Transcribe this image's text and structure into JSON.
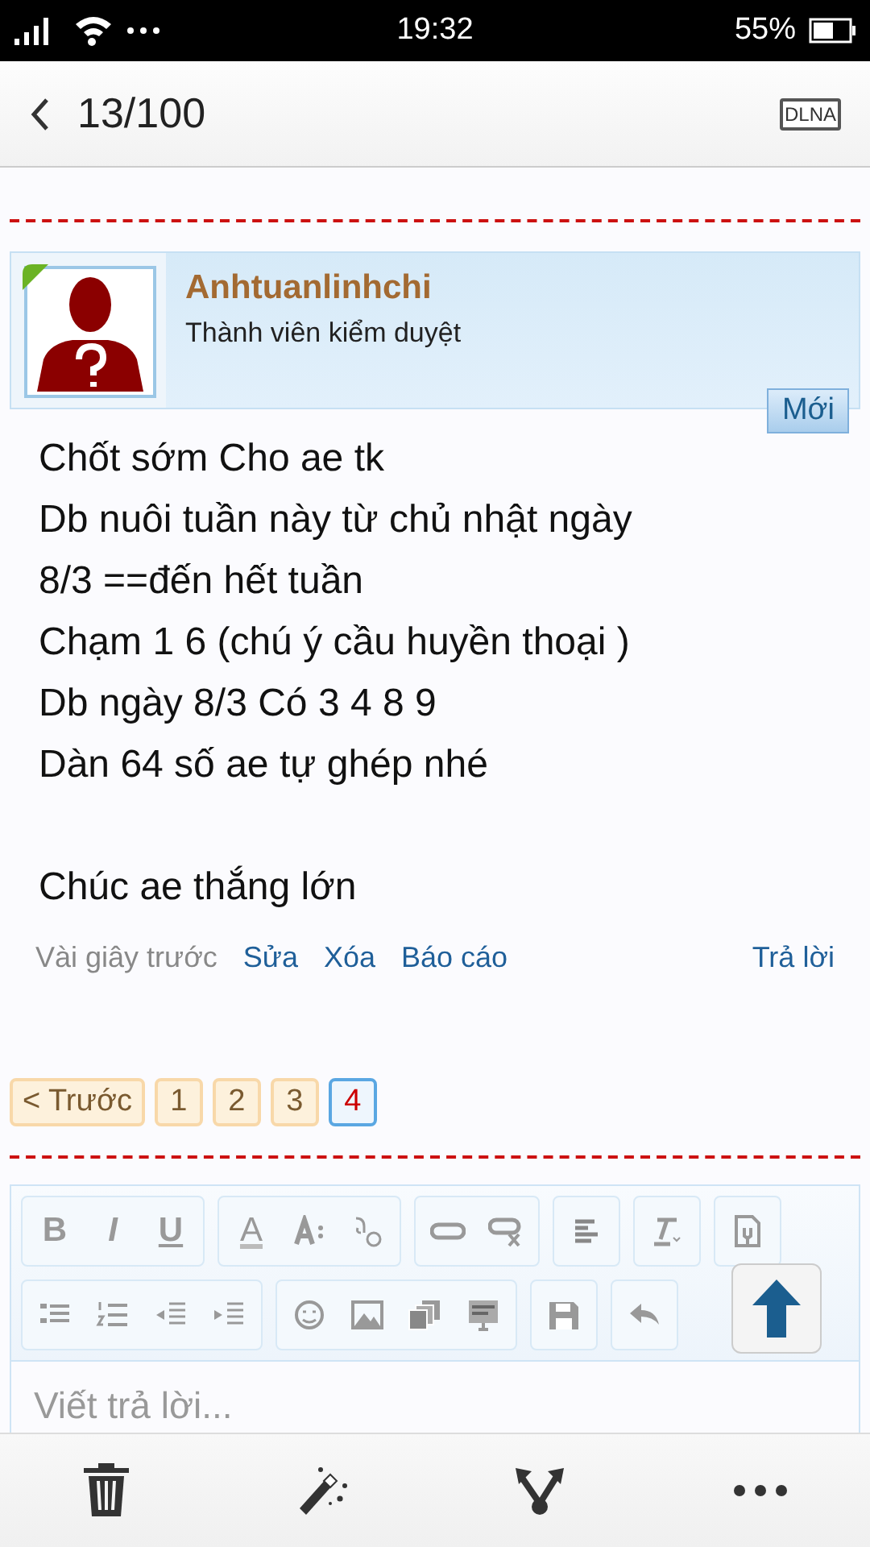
{
  "status_bar": {
    "time": "19:32",
    "battery": "55%"
  },
  "header": {
    "title": "13/100",
    "dlna": "DLNA"
  },
  "post": {
    "author": "Anhtuanlinhchi",
    "role": "Thành viên kiểm duyệt",
    "online": true,
    "new_badge": "Mới",
    "paragraphs": [
      [
        "Chốt sớm Cho ae tk",
        "Db nuôi tuần này từ chủ nhật ngày",
        "8/3 ==đến hết tuần",
        "Chạm 1 6 (chú ý cầu huyền thoại )",
        "Db ngày 8/3 Có 3 4 8 9",
        "Dàn 64 số ae tự ghép nhé"
      ],
      [
        "Chúc ae thắng lớn"
      ]
    ],
    "time": "Vài giây trước",
    "actions": [
      "Sửa",
      "Xóa",
      "Báo cáo"
    ],
    "reply": "Trả lời"
  },
  "pagination": [
    {
      "label": "< Trước",
      "selected": false
    },
    {
      "label": "1",
      "selected": false
    },
    {
      "label": "2",
      "selected": false
    },
    {
      "label": "3",
      "selected": false
    },
    {
      "label": "4",
      "selected": true
    }
  ],
  "editor": {
    "toolbar_rows": [
      [
        [
          {
            "kind": "glyph",
            "label": "B"
          },
          {
            "kind": "glyph",
            "label": "I"
          },
          {
            "kind": "glyph",
            "label": "U"
          }
        ],
        [
          {
            "kind": "glyph",
            "label": "A"
          },
          {
            "kind": "icon"
          },
          {
            "kind": "icon"
          }
        ],
        [
          {
            "kind": "icon"
          },
          {
            "kind": "icon"
          }
        ],
        [
          {
            "kind": "icon"
          }
        ],
        [
          {
            "kind": "icon"
          }
        ],
        [
          {
            "kind": "icon"
          }
        ]
      ],
      [
        [
          {
            "kind": "icon"
          },
          {
            "kind": "icon"
          },
          {
            "kind": "icon"
          },
          {
            "kind": "icon"
          }
        ],
        [
          {
            "kind": "icon"
          },
          {
            "kind": "icon"
          },
          {
            "kind": "icon"
          },
          {
            "kind": "icon"
          }
        ],
        [
          {
            "kind": "icon"
          }
        ],
        [
          {
            "kind": "icon"
          }
        ]
      ]
    ],
    "placeholder": "Viết trả lời..."
  }
}
